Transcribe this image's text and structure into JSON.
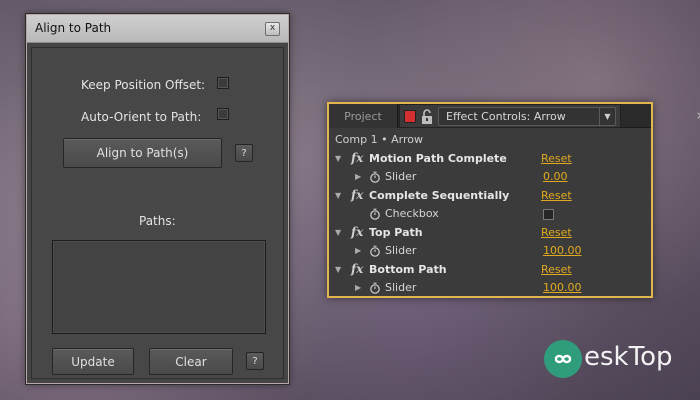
{
  "align_panel": {
    "title": "Align to Path",
    "close_glyph": "x",
    "keep_position_offset_label": "Keep Position Offset:",
    "auto_orient_label": "Auto-Orient to Path:",
    "align_button_label": "Align to Path(s)",
    "help_label": "?",
    "paths_label": "Paths:",
    "update_label": "Update",
    "clear_label": "Clear"
  },
  "effect_controls": {
    "project_tab": "Project",
    "active_tab": "Effect Controls: Arrow",
    "close_glyph": "×",
    "breadcrumb": "Comp 1 • Arrow",
    "accent_color": "#e0a91f",
    "effects": [
      {
        "name": "Motion Path Complete",
        "reset": "Reset",
        "param": "Slider",
        "value": "0.00",
        "type": "slider"
      },
      {
        "name": "Complete Sequentially",
        "reset": "Reset",
        "param": "Checkbox",
        "value": "",
        "type": "checkbox"
      },
      {
        "name": "Top Path",
        "reset": "Reset",
        "param": "Slider",
        "value": "100.00",
        "type": "slider"
      },
      {
        "name": "Bottom Path",
        "reset": "Reset",
        "param": "Slider",
        "value": "100.00",
        "type": "slider"
      }
    ],
    "fx_badge": "fx"
  },
  "watermark": {
    "text": "eskTop",
    "brand_color": "#2f9d7c"
  }
}
